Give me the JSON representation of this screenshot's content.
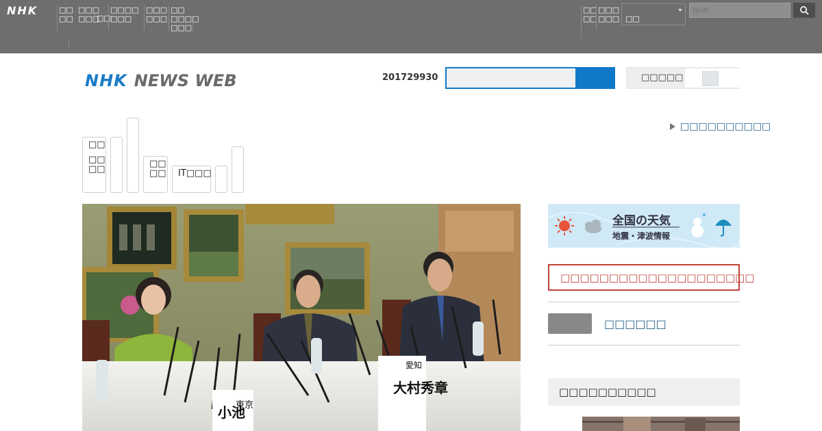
{
  "globalbar": {
    "logo": "NHK",
    "links": [
      [
        "□□",
        "□□"
      ],
      [
        "□□□",
        "□□□"
      ],
      [
        "□□"
      ],
      [
        "□□□□",
        "□□□"
      ],
      [
        "□□□",
        "□□□"
      ],
      [
        "□□",
        "□□□□",
        "□□□"
      ],
      [
        "□□",
        "□□"
      ],
      [
        "□□□",
        "□□□"
      ]
    ],
    "select_value": "□□",
    "search_placeholder": "NHK",
    "search_icon": "search-icon"
  },
  "header": {
    "brand_nhk": "NHK",
    "brand_news": "NEWS WEB",
    "datestamp": "201729930",
    "toggle_label": "□□□□□"
  },
  "tabs": [
    [
      "□□",
      "",
      "□□",
      "□□"
    ],
    [],
    [],
    [
      "□□",
      "□□"
    ],
    [
      "IT□□□"
    ],
    [],
    []
  ],
  "all_news_link": "□□□□□□□□□□",
  "weather": {
    "line1": "全国の天気",
    "line2": "地震・津波情報"
  },
  "alert_text": "□□□□□□□□□□□□□□□□□□□□",
  "side_link": "□□□□□□",
  "ranking_title": "□□□□□□□□□□",
  "photo": {
    "nameplate_center": [
      "愛知",
      "大村秀章"
    ],
    "nameplate_left": [
      "東京",
      "小池"
    ]
  },
  "colors": {
    "globalbar": "#6e6e6e",
    "brand_blue": "#1a7cc8",
    "alert_red": "#c0403a",
    "link_blue": "#1f5f8a"
  }
}
